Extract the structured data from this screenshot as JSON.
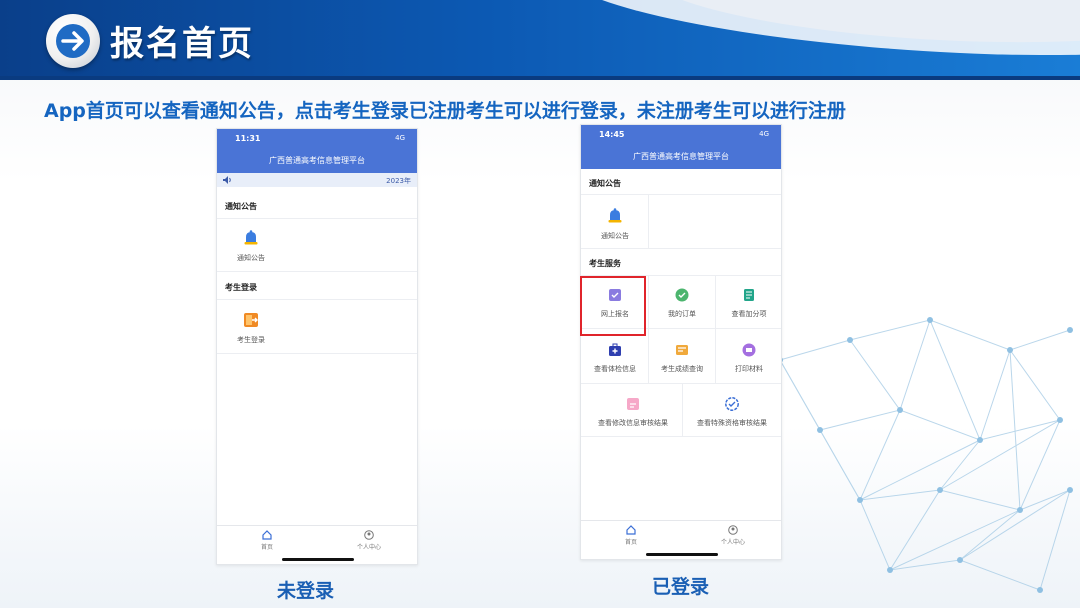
{
  "header": {
    "title": "报名首页"
  },
  "subtitle": "App首页可以查看通知公告，点击考生登录已注册考生可以进行登录，未注册考生可以进行注册",
  "left_phone": {
    "time": "11:31",
    "signal": "4G",
    "app_title": "广西普通高考信息管理平台",
    "notice_text": "2023年",
    "section1_title": "通知公告",
    "tile1_label": "通知公告",
    "section2_title": "考生登录",
    "tile2_label": "考生登录",
    "tab_home": "首页",
    "tab_profile": "个人中心",
    "caption": "未登录"
  },
  "right_phone": {
    "time": "14:45",
    "signal": "4G",
    "app_title": "广西普通高考信息管理平台",
    "section1_title": "通知公告",
    "tile_notice": "通知公告",
    "section2_title": "考生服务",
    "services": [
      "网上报名",
      "我的订单",
      "查看加分项",
      "查看体检信息",
      "考生成绩查询",
      "打印材料",
      "查看修改信息审核结果",
      "查看特殊资格审核结果"
    ],
    "tab_home": "首页",
    "tab_profile": "个人中心",
    "caption": "已登录"
  },
  "colors": {
    "header_blue": "#0c59b3",
    "app_blue": "#4a74d6",
    "subtitle_blue": "#1565c0",
    "highlight_red": "#e0242b"
  },
  "icons": [
    "arrow-right-icon",
    "bell-icon",
    "login-door-icon",
    "register-book-icon",
    "order-icon",
    "bonus-list-icon",
    "medical-kit-icon",
    "score-card-icon",
    "print-icon",
    "edit-review-icon",
    "special-check-icon",
    "home-icon",
    "person-icon"
  ]
}
